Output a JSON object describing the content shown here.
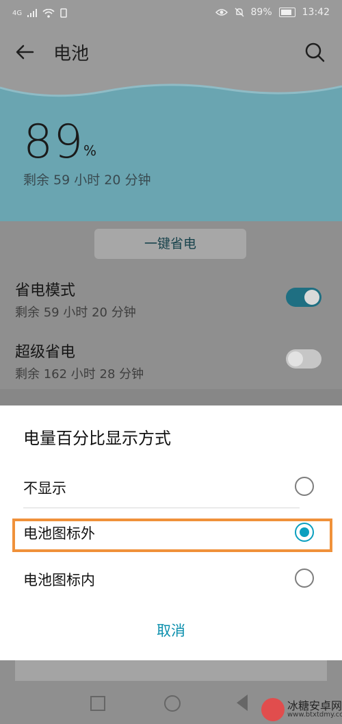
{
  "status_bar": {
    "network": "4G",
    "battery_percent": "89%",
    "time": "13:42"
  },
  "header": {
    "title": "电池"
  },
  "hero": {
    "percent_value": "89",
    "percent_unit": "%",
    "remaining": "剩余 59 小时 20 分钟"
  },
  "actions": {
    "one_key_label": "一键省电"
  },
  "rows": [
    {
      "title": "省电模式",
      "subtitle": "剩余 59 小时 20 分钟",
      "enabled": true
    },
    {
      "title": "超级省电",
      "subtitle": "剩余 162 小时 28 分钟",
      "enabled": false
    }
  ],
  "dialog": {
    "title": "电量百分比显示方式",
    "options": [
      {
        "label": "不显示",
        "selected": false
      },
      {
        "label": "电池图标外",
        "selected": true
      },
      {
        "label": "电池图标内",
        "selected": false
      }
    ],
    "cancel": "取消"
  },
  "colors": {
    "accent": "#0a9fbf",
    "highlight": "#f0913a",
    "hero": "#6aa5b1"
  },
  "watermark": {
    "name": "冰糖安卓网",
    "url": "www.btxtdmy.com"
  }
}
